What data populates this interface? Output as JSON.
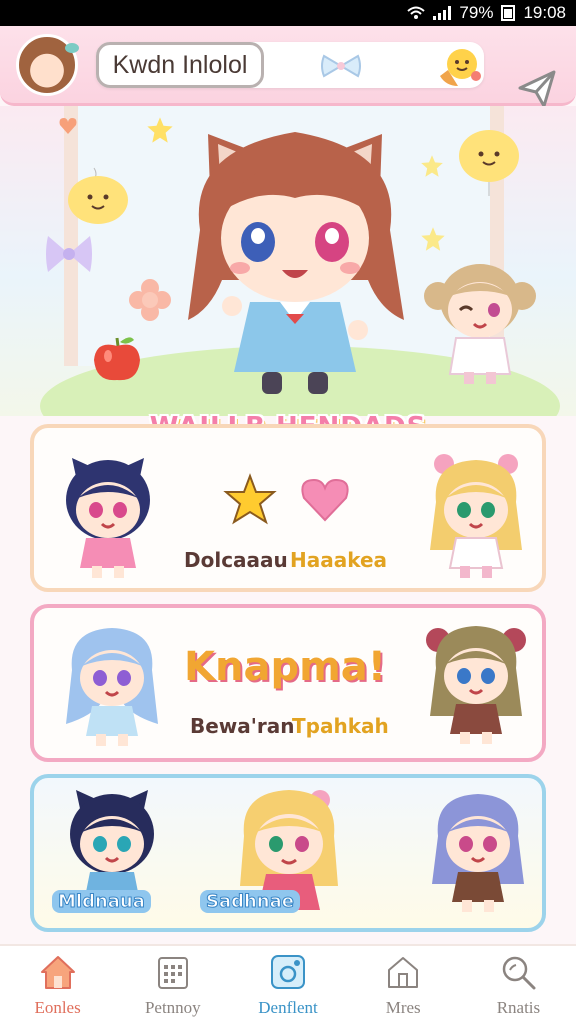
{
  "status_bar": {
    "battery": "79%",
    "time": "19:08"
  },
  "header": {
    "title": "Kwdn Inlolol"
  },
  "section": {
    "title": "WAILLB HENDADS"
  },
  "cards": [
    {
      "label_a": "Dolcaaau",
      "label_b": "Haaakea"
    },
    {
      "headline": "Knapma!",
      "label_a": "Bewa'ran",
      "label_b": "Tpahkah"
    },
    {
      "label_a": "Mldnaua",
      "label_b": "Sadhnae"
    }
  ],
  "bottom_nav": [
    {
      "label": "Eonles",
      "icon": "home-icon"
    },
    {
      "label": "Petnnoy",
      "icon": "calendar-icon"
    },
    {
      "label": "Denflent",
      "icon": "gallery-icon"
    },
    {
      "label": "Mres",
      "icon": "house-icon"
    },
    {
      "label": "Rnatis",
      "icon": "search-icon"
    }
  ],
  "colors": {
    "accent_pink": "#f47ea9",
    "header_bg": "#fde1ea",
    "active_nav": "#e06f5c",
    "current_nav": "#3a93c7"
  }
}
